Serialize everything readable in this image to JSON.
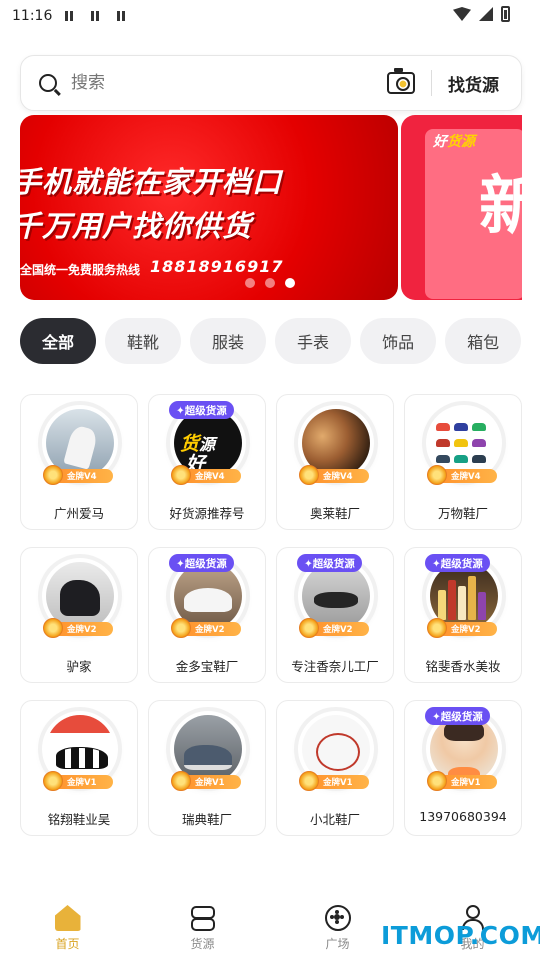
{
  "status_bar": {
    "time": "11:16"
  },
  "search": {
    "placeholder": "搜索",
    "find_source": "找货源"
  },
  "banner": {
    "line1": "手机就能在家开档口",
    "line2": "千万用户找你供货",
    "hotline_label": "全国统一免费服务热线",
    "phone": "18818916917",
    "active_slide": 3,
    "total_slides": 3
  },
  "banner_next": {
    "logo_a": "好",
    "logo_b": "货源",
    "big_char": "新"
  },
  "categories": [
    "全部",
    "鞋靴",
    "服装",
    "手表",
    "饰品",
    "箱包"
  ],
  "active_category": "全部",
  "shops": [
    {
      "name": "广州爱马",
      "level": "金牌V4",
      "super": false
    },
    {
      "name": "好货源推荐号",
      "level": "金牌V4",
      "super": true,
      "avatar_text_a": "好",
      "avatar_text_b": "货",
      "avatar_text_c": "源"
    },
    {
      "name": "奥莱鞋厂",
      "level": "金牌V4",
      "super": false
    },
    {
      "name": "万物鞋厂",
      "level": "金牌V4",
      "super": false
    },
    {
      "name": "驴家",
      "level": "金牌V2",
      "super": false
    },
    {
      "name": "金多宝鞋厂",
      "level": "金牌V2",
      "super": true
    },
    {
      "name": "专注香奈儿工厂",
      "level": "金牌V2",
      "super": true
    },
    {
      "name": "铭斐香水美妆",
      "level": "金牌V2",
      "super": true
    },
    {
      "name": "铭翔鞋业吴",
      "level": "金牌V1",
      "super": false
    },
    {
      "name": "瑞典鞋厂",
      "level": "金牌V1",
      "super": false
    },
    {
      "name": "小北鞋厂",
      "level": "金牌V1",
      "super": false
    },
    {
      "name": "13970680394",
      "level": "金牌V1",
      "super": true
    }
  ],
  "super_badge": "✦超级货源",
  "bottom_nav": [
    {
      "label": "首页",
      "icon": "home-icon",
      "active": true
    },
    {
      "label": "货源",
      "icon": "goods-icon",
      "active": false
    },
    {
      "label": "广场",
      "icon": "plaza-icon",
      "active": false
    },
    {
      "label": "我的",
      "icon": "me-icon",
      "active": false
    }
  ],
  "watermark": "ITMOP.COM",
  "colors": {
    "active_tab": "#2b2c31",
    "super_badge": "#6a50f3",
    "nav_active": "#d9a321",
    "banner": "#e40000"
  }
}
